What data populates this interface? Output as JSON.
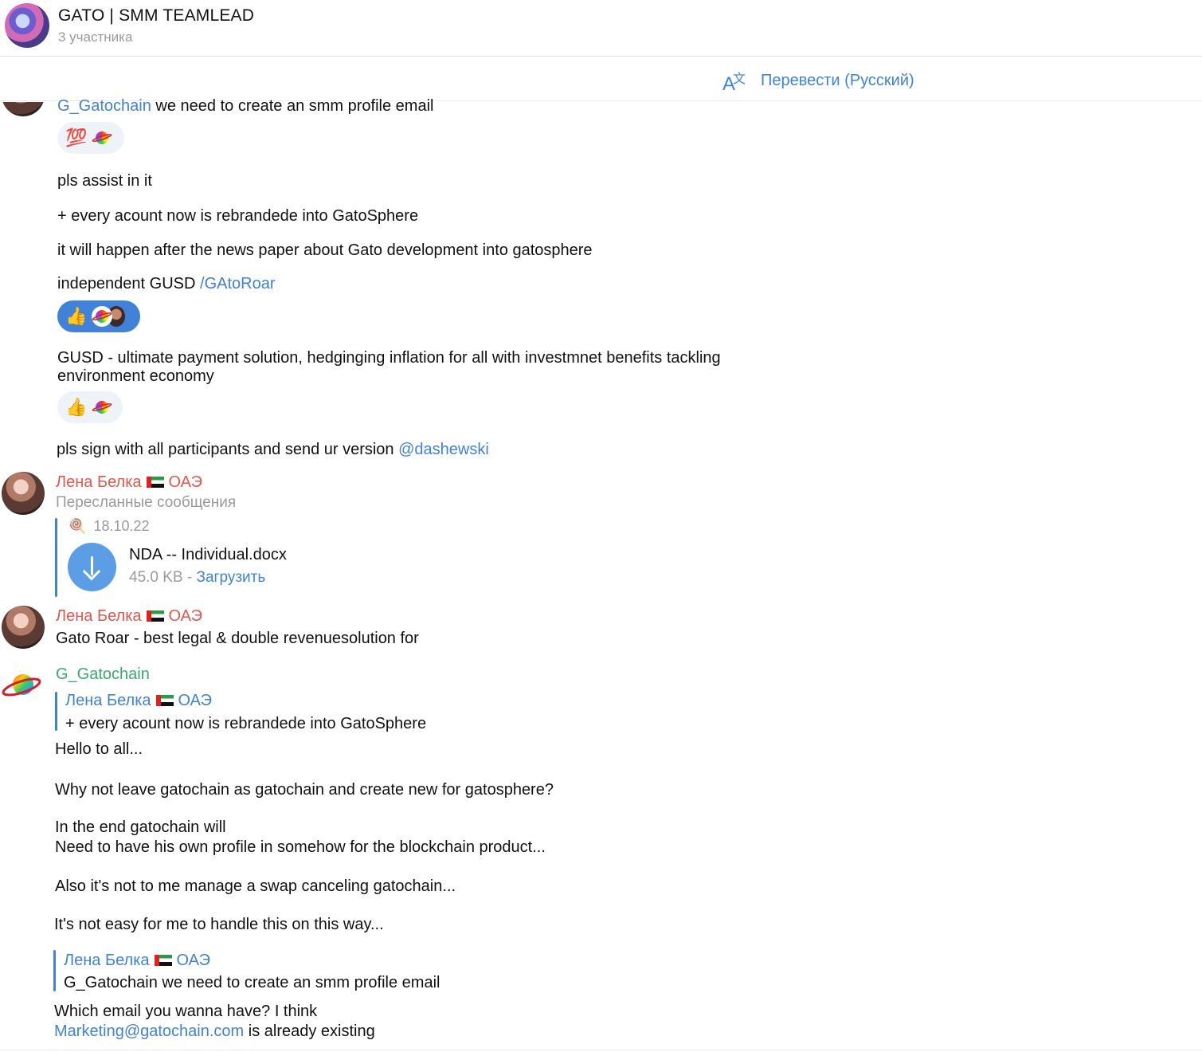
{
  "header": {
    "title": "GATO | SMM TEAMLEAD",
    "subtitle": "3 участника"
  },
  "translate": {
    "label": "Перевести (Русский)"
  },
  "messages": {
    "m1": {
      "mention": "G_Gatochain",
      "text": " we need to create an smm profile email",
      "reaction_emoji": "💯"
    },
    "m2": {
      "text": "pls assist in it"
    },
    "m3": {
      "text": "+ every acount now is rebrandede into GatoSphere"
    },
    "m4": {
      "text": "it will happen after the news paper about Gato development into gatosphere"
    },
    "m5": {
      "text": "independent GUSD ",
      "command": "/GAtoRoar",
      "reaction_emoji": "👍"
    },
    "m6": {
      "line1": "GUSD  - ultimate payment solution, hedginging inflation for all with investmnet benefits tackling",
      "line2": "environment economy",
      "reaction_emoji": "👍"
    },
    "m7": {
      "text": "pls sign with all participants and send ur version ",
      "mention": "@dashewski"
    },
    "m8": {
      "sender": "Лена Белка",
      "sender_suffix": "ОАЭ",
      "forwarded_label": "Пересланные сообщения",
      "fwd_icon": "🍭",
      "fwd_date": "18.10.22",
      "file_name": "NDA -- Individual.docx",
      "file_size": "45.0 KB - ",
      "file_action": "Загрузить"
    },
    "m9": {
      "sender": "Лена Белка",
      "sender_suffix": "ОАЭ",
      "text": "Gato Roar - best legal & double revenuesolution for"
    },
    "m10": {
      "sender": "G_Gatochain",
      "reply1_name": "Лена Белка",
      "reply1_suffix": "ОАЭ",
      "reply1_text": "+ every acount now is rebrandede into GatoSphere",
      "line1": "Hello to all...",
      "line2": "Why not leave gatochain as gatochain and create new for gatosphere?",
      "line3": "In the end gatochain will",
      "line4": "Need to have his own profile in somehow for the blockchain product...",
      "line5": "Also it's not to me manage a swap canceling gatochain...",
      "line6": "It's not easy for me to handle this on this way...",
      "reply2_name": "Лена Белка",
      "reply2_suffix": "ОАЭ",
      "reply2_text": "G_Gatochain we need to create an smm profile email",
      "line7": "Which email you wanna have? I think",
      "email_link": "Marketing@gatochain.com",
      "line8_tail": " is already existing"
    }
  }
}
